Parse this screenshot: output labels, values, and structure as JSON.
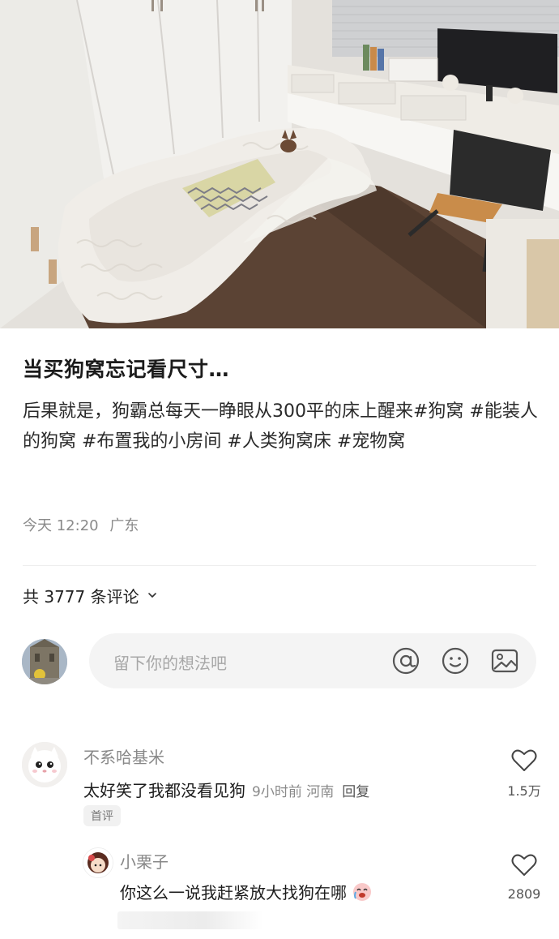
{
  "post": {
    "title": "当买狗窝忘记看尺寸…",
    "body": "后果就是，狗霸总每天一睁眼从300平的床上醒来#狗窝 #能装人的狗窝 #布置我的小房间 #人类狗窝床 #宠物窝",
    "time": "今天 12:20",
    "location": "广东"
  },
  "comments_header": {
    "label": "共 3777 条评论"
  },
  "input": {
    "placeholder": "留下你的想法吧",
    "at_icon": "at-icon",
    "emoji_icon": "smile-icon",
    "image_icon": "image-icon"
  },
  "comments": [
    {
      "user": "不系哈基米",
      "text": "太好笑了我都没看见狗",
      "time": "9小时前",
      "location": "河南",
      "reply": "回复",
      "badge": "首评",
      "likes": "1.5万"
    },
    {
      "user": "小栗子",
      "text": "你这么一说我赶紧放大找狗在哪",
      "likes": "2809"
    }
  ],
  "colors": {
    "text": "#222222",
    "muted": "#8a8a8a",
    "input_bg": "#f4f4f4"
  }
}
